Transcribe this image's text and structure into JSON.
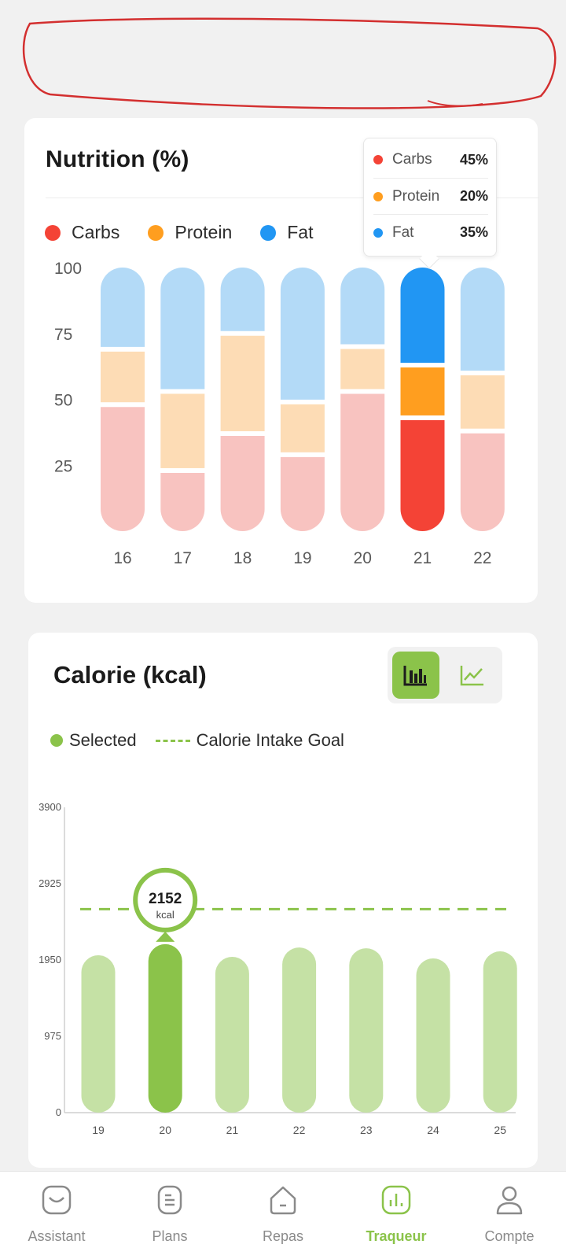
{
  "nutrition": {
    "title": "Nutrition (%)",
    "legend": [
      {
        "label": "Carbs",
        "color": "#f44336"
      },
      {
        "label": "Protein",
        "color": "#ff9e1f"
      },
      {
        "label": "Fat",
        "color": "#2196f3"
      }
    ],
    "tooltip": {
      "rows": [
        {
          "label": "Carbs",
          "value": "45%",
          "color": "#f44336"
        },
        {
          "label": "Protein",
          "value": "20%",
          "color": "#ff9e1f"
        },
        {
          "label": "Fat",
          "value": "35%",
          "color": "#2196f3"
        }
      ]
    }
  },
  "calorie": {
    "title": "Calorie (kcal)",
    "legend_selected": "Selected",
    "legend_goal": "Calorie Intake Goal",
    "selected_value": "2152",
    "selected_unit": "kcal",
    "toggle_icons": [
      "bar-chart-icon",
      "line-chart-icon"
    ]
  },
  "chart_data": [
    {
      "type": "bar",
      "stacked": true,
      "categories": [
        "16",
        "17",
        "18",
        "19",
        "20",
        "21",
        "22"
      ],
      "yticks": [
        100,
        75,
        50,
        25
      ],
      "ylim": [
        0,
        100
      ],
      "selected_index": 5,
      "series": [
        {
          "name": "Carbs",
          "values": [
            48,
            23,
            37,
            29,
            53,
            43,
            38
          ],
          "color": "#f44336",
          "light": "#f8c3c0"
        },
        {
          "name": "Protein",
          "values": [
            21,
            30,
            38,
            20,
            17,
            20,
            22
          ],
          "color": "#ff9e1f",
          "light": "#fddcb5"
        },
        {
          "name": "Fat",
          "values": [
            31,
            47,
            25,
            51,
            30,
            37,
            40
          ],
          "color": "#2196f3",
          "light": "#b3daf7"
        }
      ],
      "grid": false,
      "legend_placement": "top-left"
    },
    {
      "type": "bar",
      "categories": [
        "19",
        "20",
        "21",
        "22",
        "23",
        "24",
        "25"
      ],
      "values": [
        2010,
        2152,
        1990,
        2110,
        2100,
        1970,
        2060
      ],
      "yticks": [
        3900,
        2925,
        1950,
        975,
        0
      ],
      "ylim": [
        0,
        3900
      ],
      "goal": 2600,
      "selected_index": 1,
      "color_selected": "#8bc34a",
      "color_other": "#c5e1a5",
      "grid": false,
      "legend_placement": "top-left"
    }
  ],
  "nav": {
    "items": [
      {
        "label": "Assistant",
        "icon": "chat-bubble-icon",
        "active": false
      },
      {
        "label": "Plans",
        "icon": "document-icon",
        "active": false
      },
      {
        "label": "Repas",
        "icon": "home-icon",
        "active": false
      },
      {
        "label": "Traqueur",
        "icon": "tracker-chart-icon",
        "active": true
      },
      {
        "label": "Compte",
        "icon": "user-icon",
        "active": false
      }
    ]
  },
  "colors": {
    "accent": "#8bc34a",
    "annotation": "#d32f2f"
  }
}
